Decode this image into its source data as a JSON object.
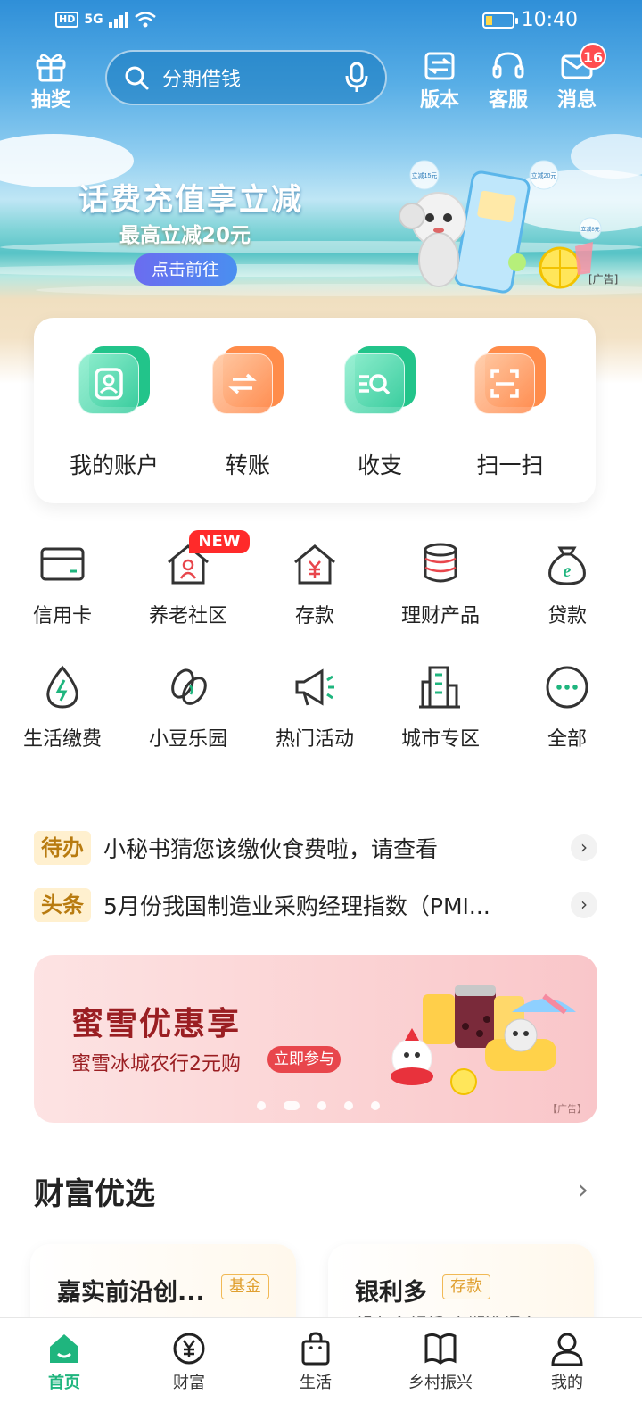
{
  "status_bar": {
    "network": "5G",
    "hd": "HD",
    "time": "10:40"
  },
  "top_bar": {
    "lottery_label": "抽奖",
    "search_placeholder": "分期借钱",
    "version_label": "版本",
    "service_label": "客服",
    "message_label": "消息",
    "message_badge": "16"
  },
  "banner": {
    "title": "话费充值享立减",
    "subtitle": "最高立减20元",
    "button": "点击前往",
    "ad_tag": "[广告]",
    "coupon_1": "立减15元",
    "coupon_2": "立减20元",
    "coupon_3": "立减8元"
  },
  "quick_actions": [
    {
      "label": "我的账户",
      "icon": "account-icon"
    },
    {
      "label": "转账",
      "icon": "transfer-icon"
    },
    {
      "label": "收支",
      "icon": "income-expense-icon"
    },
    {
      "label": "扫一扫",
      "icon": "scan-icon"
    }
  ],
  "grid": [
    {
      "label": "信用卡",
      "icon": "credit-card-icon"
    },
    {
      "label": "养老社区",
      "icon": "elderly-home-icon",
      "tag": "NEW"
    },
    {
      "label": "存款",
      "icon": "deposit-icon"
    },
    {
      "label": "理财产品",
      "icon": "wealth-coins-icon"
    },
    {
      "label": "贷款",
      "icon": "loan-bag-icon"
    },
    {
      "label": "生活缴费",
      "icon": "utility-drop-icon"
    },
    {
      "label": "小豆乐园",
      "icon": "beans-icon"
    },
    {
      "label": "热门活动",
      "icon": "megaphone-icon"
    },
    {
      "label": "城市专区",
      "icon": "city-buildings-icon"
    },
    {
      "label": "全部",
      "icon": "more-dots-icon"
    }
  ],
  "news": [
    {
      "tag": "待办",
      "text": "小秘书猜您该缴伙食费啦，请查看"
    },
    {
      "tag": "头条",
      "text": "5月份我国制造业采购经理指数（PMI..."
    }
  ],
  "promo": {
    "title": "蜜雪优惠享",
    "subtitle": "蜜雪冰城农行2元购",
    "button": "立即参与",
    "ad_tag": "【广告】",
    "active_slide": 2,
    "slide_count": 5
  },
  "wealth": {
    "title": "财富优选",
    "cards": [
      {
        "name": "嘉实前沿创...",
        "tag": "基金",
        "sub": ""
      },
      {
        "name": "银利多",
        "tag": "存款",
        "sub": "起存金额低 定期选择多"
      }
    ]
  },
  "bottom_nav": [
    {
      "label": "首页",
      "icon": "home-icon",
      "active": true
    },
    {
      "label": "财富",
      "icon": "yuan-icon",
      "active": false
    },
    {
      "label": "生活",
      "icon": "shopping-bag-icon",
      "active": false
    },
    {
      "label": "乡村振兴",
      "icon": "book-icon",
      "active": false
    },
    {
      "label": "我的",
      "icon": "user-icon",
      "active": false
    }
  ],
  "colors": {
    "brand_green": "#1fb57e",
    "badge_red": "#ff4d4f",
    "promo_red": "#9a1e22",
    "tag_gold": "#b87b10"
  }
}
